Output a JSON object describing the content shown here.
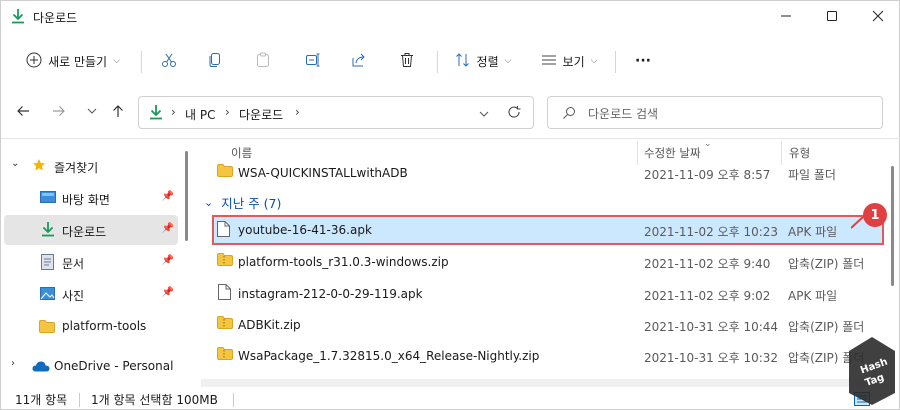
{
  "window": {
    "title": "다운로드",
    "controls": {
      "minimize": "minimize-icon",
      "maximize": "maximize-icon",
      "close": "close-icon"
    }
  },
  "toolbar": {
    "new_label": "새로 만들기",
    "sort_label": "정렬",
    "view_label": "보기",
    "more_label": "···",
    "icons": [
      "cut-icon",
      "copy-icon",
      "paste-icon",
      "rename-icon",
      "share-icon",
      "delete-icon"
    ]
  },
  "nav": {
    "breadcrumb": [
      "내 PC",
      "다운로드"
    ],
    "search_placeholder": "다운로드 검색"
  },
  "sidebar": {
    "items": [
      {
        "label": "즐겨찾기",
        "icon": "star-icon"
      },
      {
        "label": "바탕 화면",
        "icon": "desktop-icon",
        "pinned": true
      },
      {
        "label": "다운로드",
        "icon": "download-icon",
        "pinned": true,
        "selected": true
      },
      {
        "label": "문서",
        "icon": "document-icon",
        "pinned": true
      },
      {
        "label": "사진",
        "icon": "pictures-icon",
        "pinned": true
      },
      {
        "label": "platform-tools",
        "icon": "folder-icon"
      },
      {
        "label": "OneDrive - Personal",
        "icon": "cloud-icon"
      }
    ]
  },
  "columns": {
    "name": "이름",
    "date": "수정한 날짜",
    "type": "유형"
  },
  "files": {
    "top": {
      "name": "WSA-QUICKINSTALLwithADB",
      "date": "2021-11-09 오후 8:57",
      "type": "파일 폴더"
    },
    "group_label": "지난 주 (7)",
    "rows": [
      {
        "name": "youtube-16-41-36.apk",
        "date": "2021-11-02 오후 10:23",
        "type": "APK 파일",
        "selected": true
      },
      {
        "name": "platform-tools_r31.0.3-windows.zip",
        "date": "2021-11-02 오후 9:40",
        "type": "압축(ZIP) 폴더"
      },
      {
        "name": "instagram-212-0-0-29-119.apk",
        "date": "2021-11-02 오후 9:02",
        "type": "APK 파일"
      },
      {
        "name": "ADBKit.zip",
        "date": "2021-10-31 오후 10:44",
        "type": "압축(ZIP) 폴더"
      },
      {
        "name": "WsaPackage_1.7.32815.0_x64_Release-Nightly.zip",
        "date": "2021-10-31 오후 10:32",
        "type": "압축(ZIP) 폴더"
      }
    ]
  },
  "status": {
    "count": "11개 항목",
    "selection": "1개 항목 선택함 100MB"
  },
  "annotation": {
    "badge": "1"
  },
  "watermark": {
    "line1": "Hash",
    "line2": "Tag"
  },
  "colors": {
    "accent": "#0067c0",
    "download": "#1a9a5a",
    "selection": "#cce8ff",
    "highlight_border": "#e05a5a",
    "folder": "#f5c542"
  }
}
